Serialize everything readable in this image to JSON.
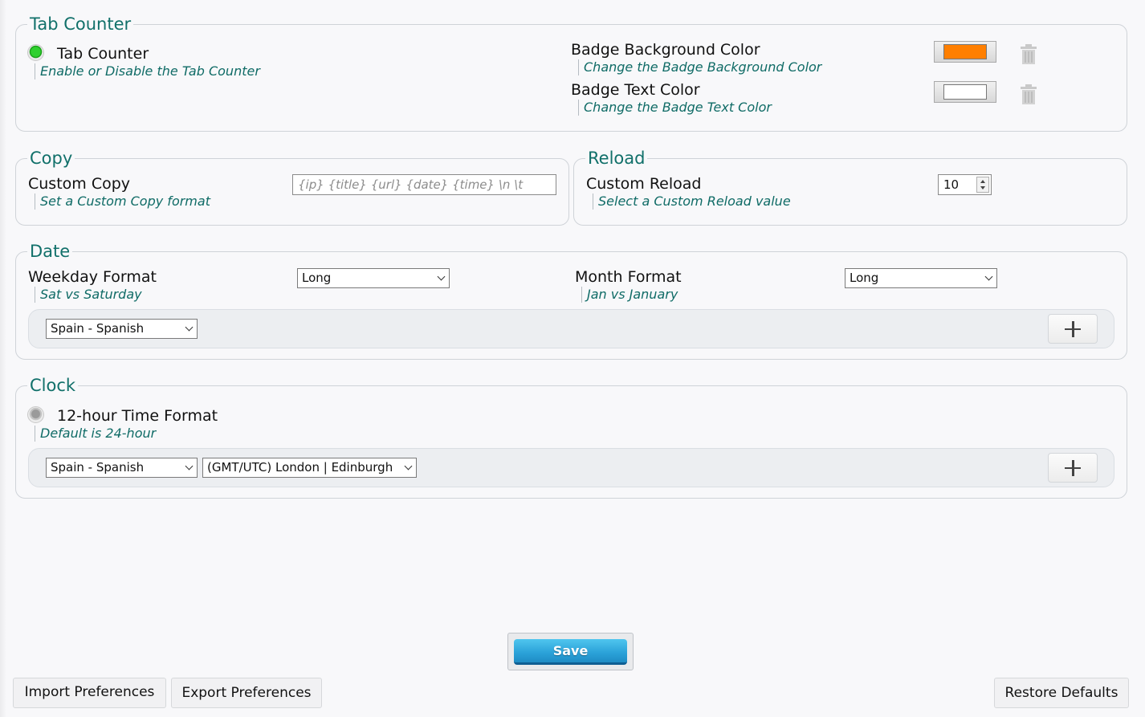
{
  "tab_counter": {
    "legend": "Tab Counter",
    "toggle_label": "Tab Counter",
    "toggle_desc": "Enable or Disable the Tab Counter",
    "toggle_on": true,
    "badge_bg": {
      "label": "Badge Background Color",
      "desc": "Change the Badge Background Color",
      "color": "#ff7f00"
    },
    "badge_text": {
      "label": "Badge Text Color",
      "desc": "Change the Badge Text Color",
      "color": "#ffffff"
    }
  },
  "copy": {
    "legend": "Copy",
    "label": "Custom Copy",
    "desc": "Set a Custom Copy format",
    "placeholder": "{ip} {title} {url} {date} {time} \\n \\t"
  },
  "reload": {
    "legend": "Reload",
    "label": "Custom Reload",
    "desc": "Select a Custom Reload value",
    "value": "10"
  },
  "date": {
    "legend": "Date",
    "weekday_label": "Weekday Format",
    "weekday_desc": "Sat vs Saturday",
    "weekday_value": "Long",
    "month_label": "Month Format",
    "month_desc": "Jan vs January",
    "month_value": "Long",
    "locale_value": "Spain - Spanish"
  },
  "clock": {
    "legend": "Clock",
    "toggle_label": "12-hour Time Format",
    "toggle_desc": "Default is 24-hour",
    "toggle_on": false,
    "locale_value": "Spain - Spanish",
    "timezone_value": "(GMT/UTC) London | Edinburgh"
  },
  "footer": {
    "save_label": "Save",
    "import_label": "Import Preferences",
    "export_label": "Export Preferences",
    "restore_label": "Restore Defaults"
  },
  "colors": {
    "accent_teal": "#11706a",
    "save_blue": "#2aa1d8"
  },
  "icons": {
    "trash": "trash-icon",
    "plus": "plus-icon",
    "chevron": "chevron-down-icon"
  }
}
